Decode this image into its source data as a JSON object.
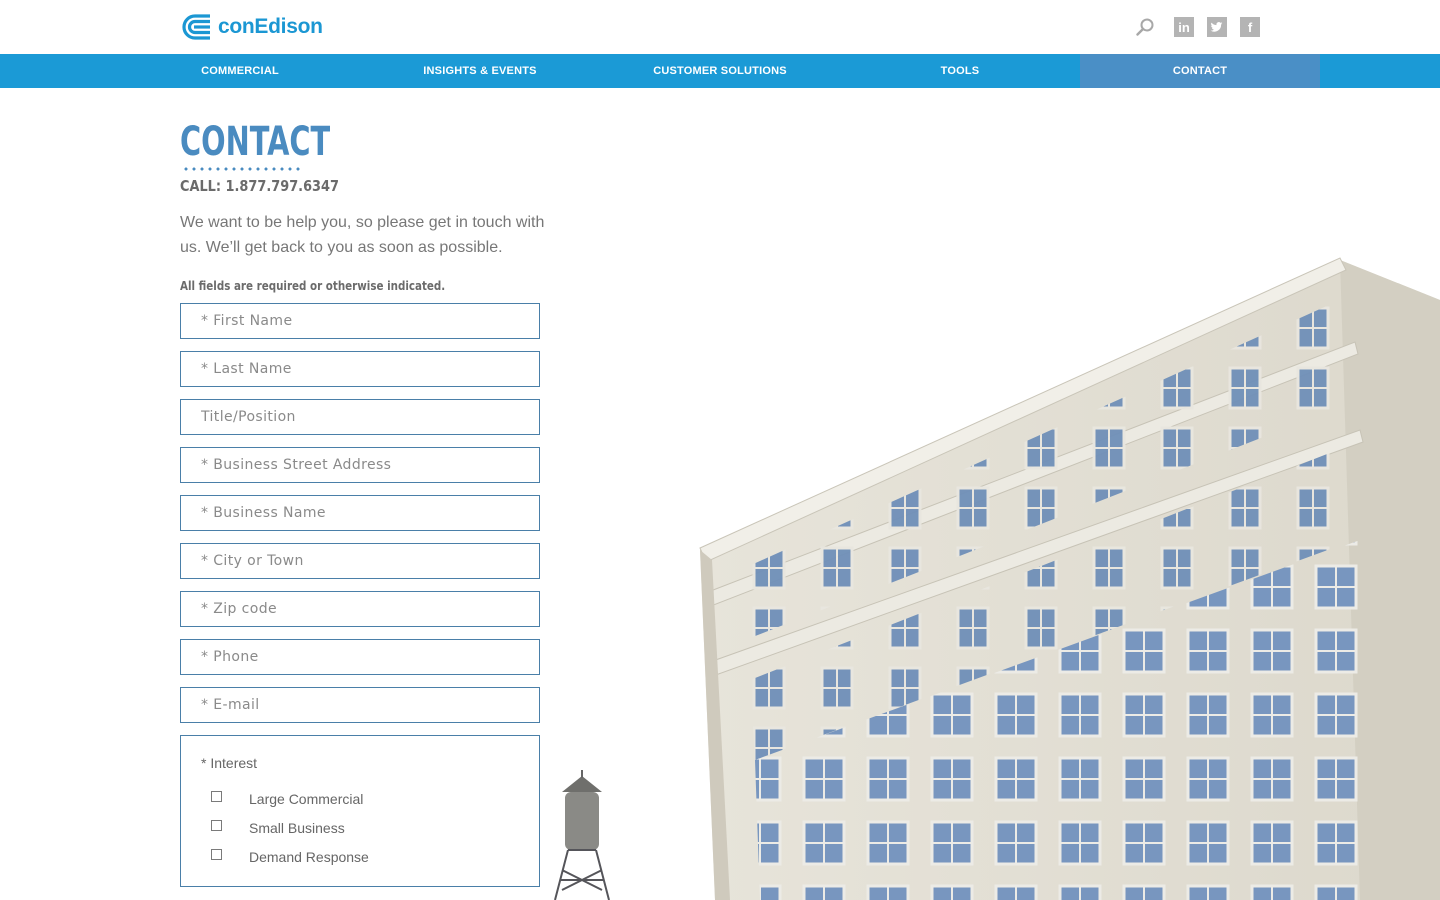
{
  "brand": {
    "name": "conEdison",
    "color": "#1b97d3"
  },
  "header": {
    "icons": [
      "search-icon",
      "linkedin-icon",
      "twitter-icon",
      "facebook-icon"
    ],
    "social_labels": {
      "linkedin": "in",
      "twitter": "t",
      "facebook": "f"
    }
  },
  "nav": {
    "items": [
      {
        "label": "COMMERCIAL",
        "active": false
      },
      {
        "label": "INSIGHTS & EVENTS",
        "active": false
      },
      {
        "label": "CUSTOMER SOLUTIONS",
        "active": false
      },
      {
        "label": "TOOLS",
        "active": false
      },
      {
        "label": "CONTACT",
        "active": true
      }
    ],
    "bar_color": "#1b9ad6",
    "active_color": "#4a8fc6"
  },
  "page": {
    "title": "CONTACT",
    "phone": "CALL: 1.877.797.6347",
    "intro": "We want to be help you, so please get in touch with us. We’ll get back to you as soon as possible.",
    "required_note": "All fields are required or otherwise indicated."
  },
  "form": {
    "fields": [
      {
        "placeholder": "* First Name",
        "value": ""
      },
      {
        "placeholder": "* Last Name",
        "value": ""
      },
      {
        "placeholder": "Title/Position",
        "value": ""
      },
      {
        "placeholder": "* Business Street Address",
        "value": ""
      },
      {
        "placeholder": "* Business Name",
        "value": ""
      },
      {
        "placeholder": "* City or Town",
        "value": ""
      },
      {
        "placeholder": "* Zip code",
        "value": ""
      },
      {
        "placeholder": "* Phone",
        "value": ""
      },
      {
        "placeholder": "* E-mail",
        "value": ""
      }
    ],
    "interest": {
      "label": "* Interest",
      "options": [
        {
          "label": "Large Commercial",
          "checked": false
        },
        {
          "label": "Small Business",
          "checked": false
        },
        {
          "label": "Demand Response",
          "checked": false
        }
      ]
    }
  }
}
